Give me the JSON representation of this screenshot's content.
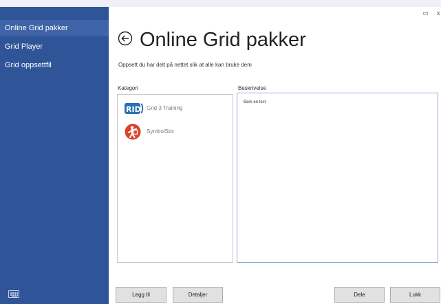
{
  "sidebar": {
    "items": [
      {
        "label": "Online Grid pakker"
      },
      {
        "label": "Grid Player"
      },
      {
        "label": "Grid oppsettfil"
      }
    ]
  },
  "header": {
    "title": "Online Grid pakker",
    "subtitle": "Oppsett du har delt på nettet slik at alle kan bruke dem"
  },
  "window": {
    "maximize_glyph": "▭",
    "close_glyph": "x"
  },
  "categories": {
    "label": "Kategori",
    "items": [
      {
        "name": "Grid 3 Training",
        "logo_text": "RID",
        "icon": "grid-logo-icon"
      },
      {
        "name": "SymbolStix",
        "icon": "symbolstix-logo-icon"
      }
    ]
  },
  "description": {
    "label": "Beskrivelse",
    "text": "Bare en test"
  },
  "buttons": {
    "add": "Legg til",
    "details": "Detaljer",
    "share": "Dele",
    "close": "Lukk"
  },
  "colors": {
    "sidebar": "#2f5497",
    "sidebar_active": "#3e63a6",
    "grid_logo": "#2b6fb6",
    "symbolstix_logo": "#d9442b"
  }
}
